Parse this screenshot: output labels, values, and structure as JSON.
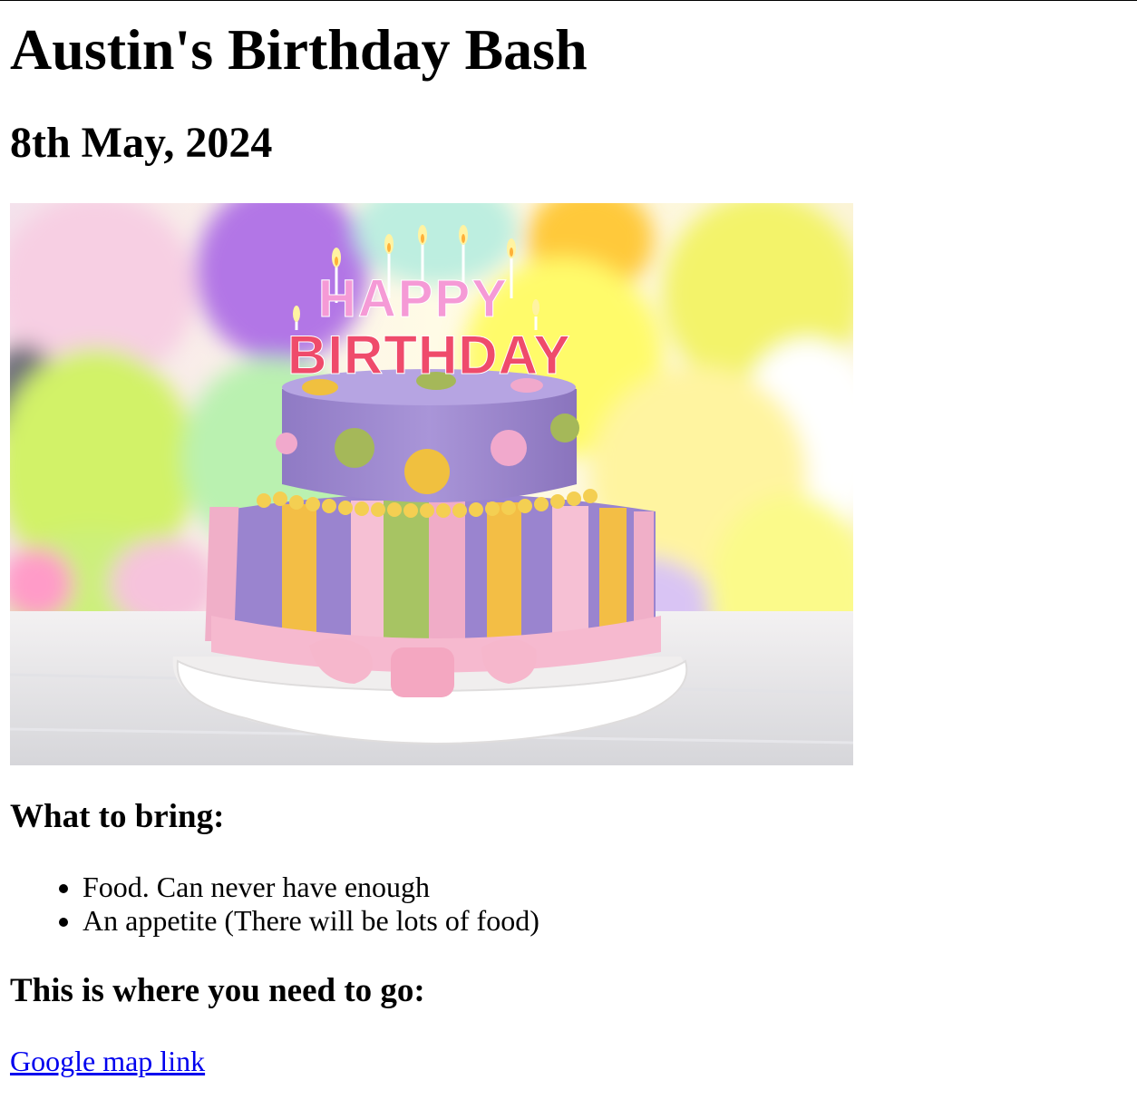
{
  "page": {
    "title": "Austin's Birthday Bash",
    "date": "8th May, 2024"
  },
  "image": {
    "cake_letters_row1": "HAPPY",
    "cake_letters_row2": "BIRTHDAY"
  },
  "bring": {
    "heading": "What to bring:",
    "items": [
      "Food. Can never have enough",
      "An appetite (There will be lots of food)"
    ]
  },
  "directions": {
    "heading": "This is where you need to go:",
    "link_text": "Google map link"
  },
  "colors": {
    "link": "#0000ee",
    "text": "#000000",
    "background": "#ffffff"
  }
}
